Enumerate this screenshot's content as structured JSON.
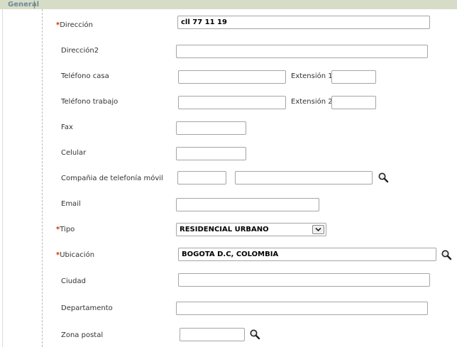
{
  "section": {
    "title": "General"
  },
  "fields": {
    "direccion": {
      "required_mark": "*",
      "label": "Dirección",
      "value": "cll 77 11 19"
    },
    "direccion2": {
      "label": "Dirección2",
      "value": ""
    },
    "telefono_casa": {
      "label": "Teléfono casa",
      "value": "",
      "extension_label": "Extensión 1",
      "extension_value": ""
    },
    "telefono_trabajo": {
      "label": "Teléfono trabajo",
      "value": "",
      "extension_label": "Extensión 2",
      "extension_value": ""
    },
    "fax": {
      "label": "Fax",
      "value": ""
    },
    "celular": {
      "label": "Celular",
      "value": ""
    },
    "compania_movil": {
      "label": "Compañia de telefonía móvil",
      "code_value": "",
      "name_value": ""
    },
    "email": {
      "label": "Email",
      "value": ""
    },
    "tipo": {
      "required_mark": "*",
      "label": "Tipo",
      "selected": "RESIDENCIAL URBANO"
    },
    "ubicacion": {
      "required_mark": "*",
      "label": "Ubicación",
      "value": "BOGOTA D.C, COLOMBIA"
    },
    "ciudad": {
      "label": "Ciudad",
      "value": ""
    },
    "departamento": {
      "label": "Departamento",
      "value": ""
    },
    "zona_postal": {
      "label": "Zona postal",
      "value": ""
    }
  },
  "icons": {
    "lookup": "magnifier-icon",
    "dropdown": "chevron-down-icon"
  },
  "colors": {
    "header_bg": "#d6dcc6",
    "header_text": "#6d8a9a",
    "required": "#cc3300"
  }
}
